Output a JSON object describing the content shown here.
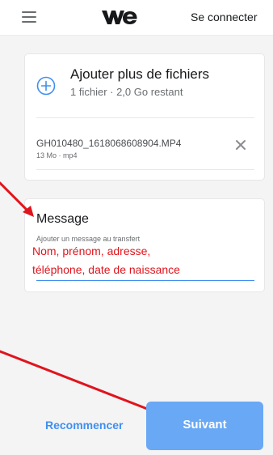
{
  "header": {
    "logo_icon": "wetransfer-logo-icon",
    "menu_icon": "hamburger-menu-icon",
    "signin_label": "Se connecter"
  },
  "files_card": {
    "add_title": "Ajouter plus de fichiers",
    "add_subtitle": "1 fichier · 2,0 Go restant",
    "add_icon": "plus-circle-icon",
    "files": [
      {
        "name": "GH010480_1618068608904.MP4",
        "meta": "13 Mo · mp4",
        "remove_icon": "close-icon"
      }
    ]
  },
  "message_card": {
    "title": "Message",
    "placeholder": "Ajouter un message au transfert"
  },
  "annotation": {
    "line1": "Nom, prénom, adresse,",
    "line2": "téléphone, date de naissance",
    "color": "#e0141c"
  },
  "footer": {
    "restart_label": "Recommencer",
    "next_label": "Suivant"
  },
  "colors": {
    "accent": "#3f8ff0",
    "next_button": "#69a8f5",
    "background": "#f4f4f5"
  }
}
